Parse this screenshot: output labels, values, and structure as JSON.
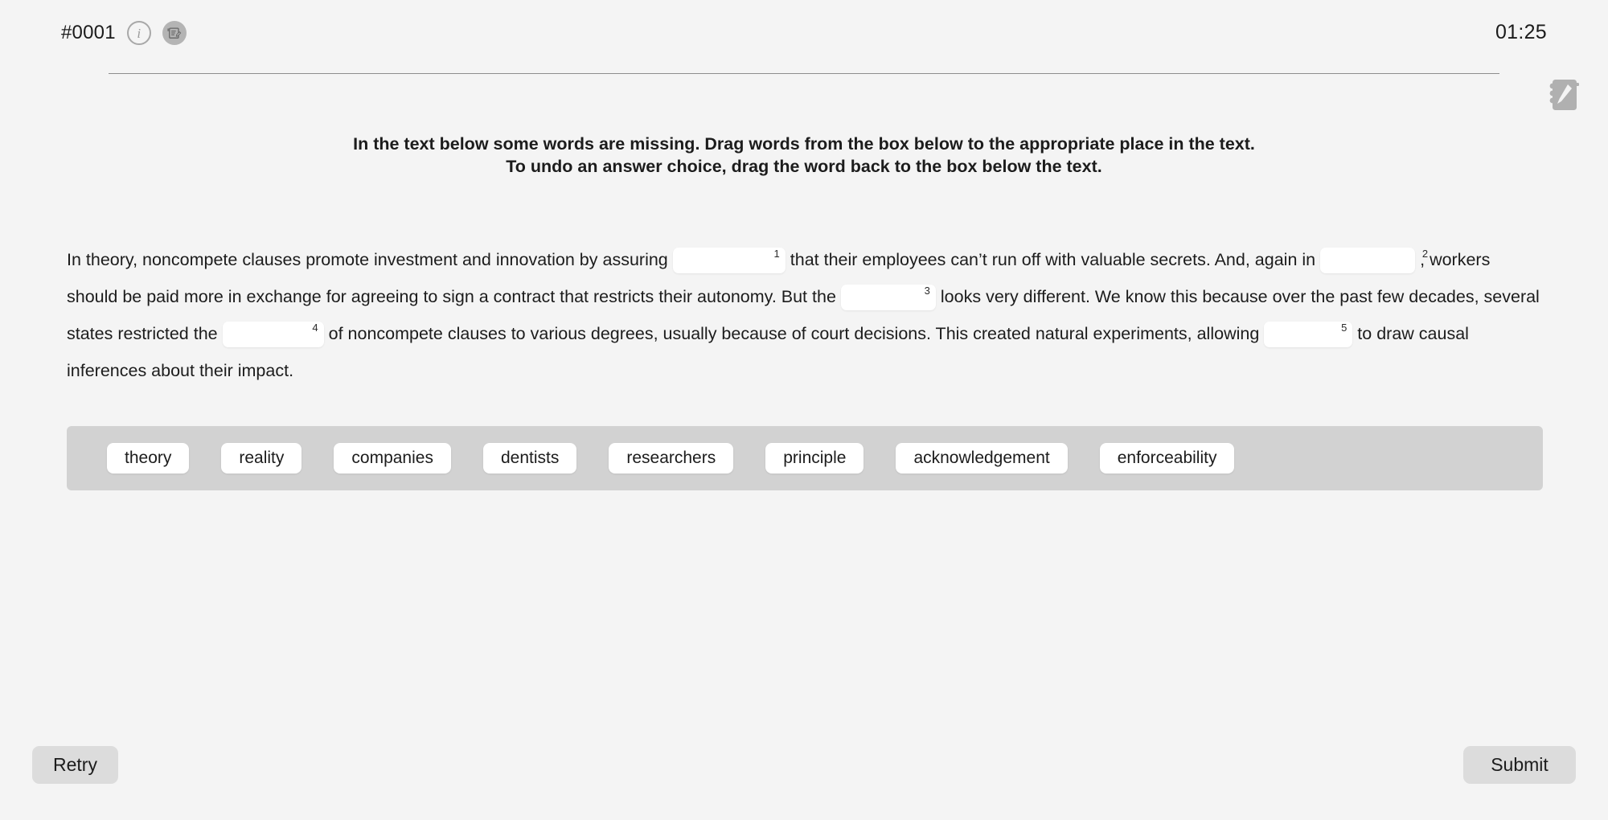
{
  "header": {
    "question_id": "#0001",
    "timer": "01:25",
    "info_icon": "info-icon",
    "note_icon": "note-icon",
    "notepad_icon": "notepad-icon"
  },
  "instructions": {
    "line1": "In the text below some words are missing. Drag words from the box below to the appropriate place in the text.",
    "line2": "To undo an answer choice, drag the word back to the box below the text."
  },
  "passage": {
    "t1": "In theory, noncompete clauses promote investment and innovation by assuring",
    "b1": "1",
    "t2": "that their employees can’t run off with valuable secrets. And, again in",
    "b2": "2",
    "t3": ", workers should be paid more in exchange for agreeing to sign a contract that restricts their autonomy. But the",
    "b3": "3",
    "t4": "looks very different. We know this because over the past few decades, several states restricted the",
    "b4": "4",
    "t5": "of noncompete clauses to various degrees, usually because of court decisions. This created natural experiments, allowing",
    "b5": "5",
    "t6": "to draw causal inferences about their impact."
  },
  "wordbank": {
    "words": [
      "theory",
      "reality",
      "companies",
      "dentists",
      "researchers",
      "principle",
      "acknowledgement",
      "enforceability"
    ]
  },
  "footer": {
    "retry_label": "Retry",
    "submit_label": "Submit"
  },
  "colors": {
    "background": "#f4f4f4",
    "wordbank_bg": "#d2d2d2",
    "chip_bg": "#ffffff",
    "button_bg": "#dcdcdc",
    "text": "#1c1c1c",
    "divider": "#8d8d8d",
    "icon_gray": "#b4b4b4"
  }
}
